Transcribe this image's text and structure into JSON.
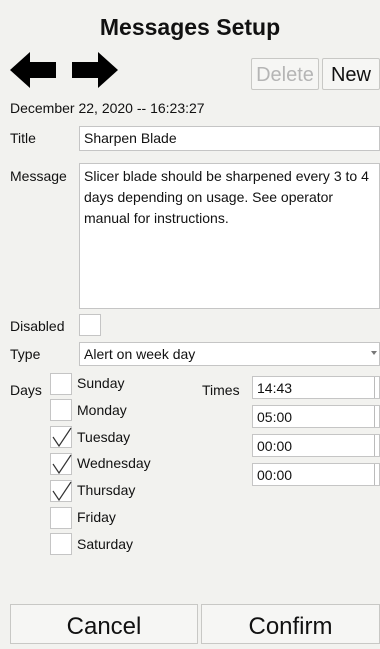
{
  "header": {
    "title": "Messages Setup"
  },
  "toolbar": {
    "back_icon": "left-arrow-icon",
    "forward_icon": "right-arrow-icon",
    "delete_label": "Delete",
    "new_label": "New"
  },
  "timestamp": "December 22, 2020 -- 16:23:27",
  "form": {
    "title_label": "Title",
    "title_value": "Sharpen Blade",
    "message_label": "Message",
    "message_value": "Slicer blade should be sharpened every 3 to 4 days depending on usage. See operator manual for instructions.",
    "disabled_label": "Disabled",
    "type_label": "Type",
    "type_value": "Alert on week day",
    "days_label": "Days",
    "times_label": "Times"
  },
  "days": [
    {
      "name": "Sunday",
      "checked": false
    },
    {
      "name": "Monday",
      "checked": false
    },
    {
      "name": "Tuesday",
      "checked": true
    },
    {
      "name": "Wednesday",
      "checked": true
    },
    {
      "name": "Thursday",
      "checked": true
    },
    {
      "name": "Friday",
      "checked": false
    },
    {
      "name": "Saturday",
      "checked": false
    }
  ],
  "times": [
    "14:43",
    "05:00",
    "00:00",
    "00:00"
  ],
  "footer": {
    "cancel_label": "Cancel",
    "confirm_label": "Confirm"
  }
}
